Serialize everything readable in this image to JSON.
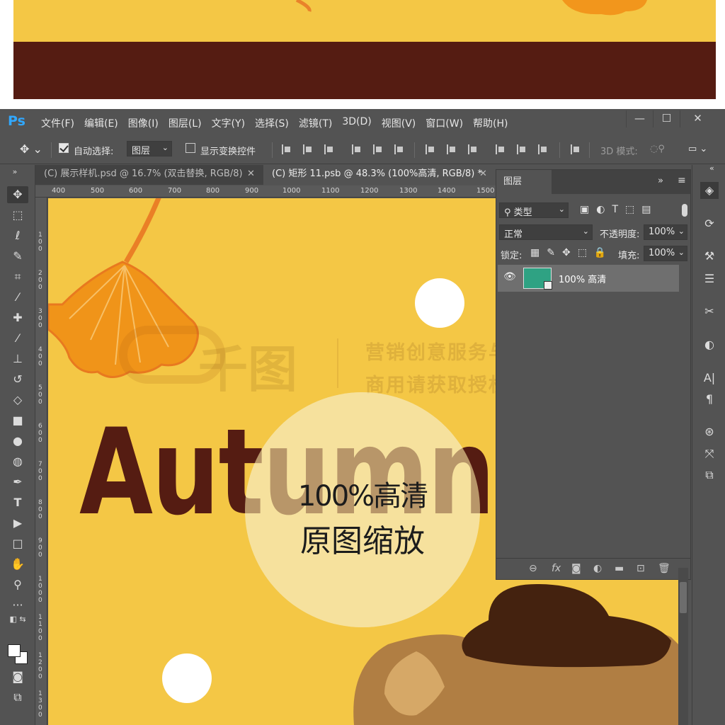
{
  "app": {
    "logo": "Ps",
    "menu": [
      "文件(F)",
      "编辑(E)",
      "图像(I)",
      "图层(L)",
      "文字(Y)",
      "选择(S)",
      "滤镜(T)",
      "3D(D)",
      "视图(V)",
      "窗口(W)",
      "帮助(H)"
    ],
    "window_controls": [
      "—",
      "☐",
      "✕"
    ]
  },
  "options_bar": {
    "auto_select_label": "自动选择:",
    "auto_select_checked": true,
    "auto_select_target": "图层",
    "show_transform_label": "显示变换控件",
    "show_transform_checked": false,
    "mode_3d_label": "3D 模式:"
  },
  "tabs": [
    {
      "label": "(C) 展示样机.psd @ 16.7% (双击替换, RGB/8)",
      "close": "✕",
      "active": false
    },
    {
      "label": "(C) 矩形 11.psb @ 48.3% (100%高清, RGB/8) *",
      "close": "✕",
      "active": true
    }
  ],
  "ruler": {
    "ticks": [
      "400",
      "500",
      "600",
      "700",
      "800",
      "900",
      "1000",
      "1100",
      "1200",
      "1300",
      "1400",
      "1500"
    ],
    "vertical_ticks": [
      "1 0 0",
      "2 0 0",
      "3 0 0",
      "4 0 0",
      "5 0 0",
      "6 0 0",
      "7 0 0",
      "8 0 0",
      "9 0 0",
      "1 0 0 0",
      "1 1 0 0",
      "1 2 0 0",
      "1 3 0 0"
    ]
  },
  "canvas": {
    "headline": "Autumn",
    "circle_text_line1": "100%高清",
    "circle_text_line2": "原图缩放",
    "watermark_logo": "千图",
    "watermark_line1": "营销创意服务与协作平台",
    "watermark_line2": "商用请获取授权"
  },
  "layers_panel": {
    "tab": "图层",
    "filter_label": "类型",
    "blend_mode": "正常",
    "opacity_label": "不透明度:",
    "opacity_value": "100%",
    "lock_label": "锁定:",
    "fill_label": "填充:",
    "fill_value": "100%",
    "layers": [
      {
        "name": "100% 高清",
        "visible": true
      }
    ]
  },
  "colors": {
    "yellow": "#f4c745",
    "dark_brown": "#551c12",
    "layer_thumb": "#2fa283",
    "ps_blue": "#31a8ff"
  }
}
